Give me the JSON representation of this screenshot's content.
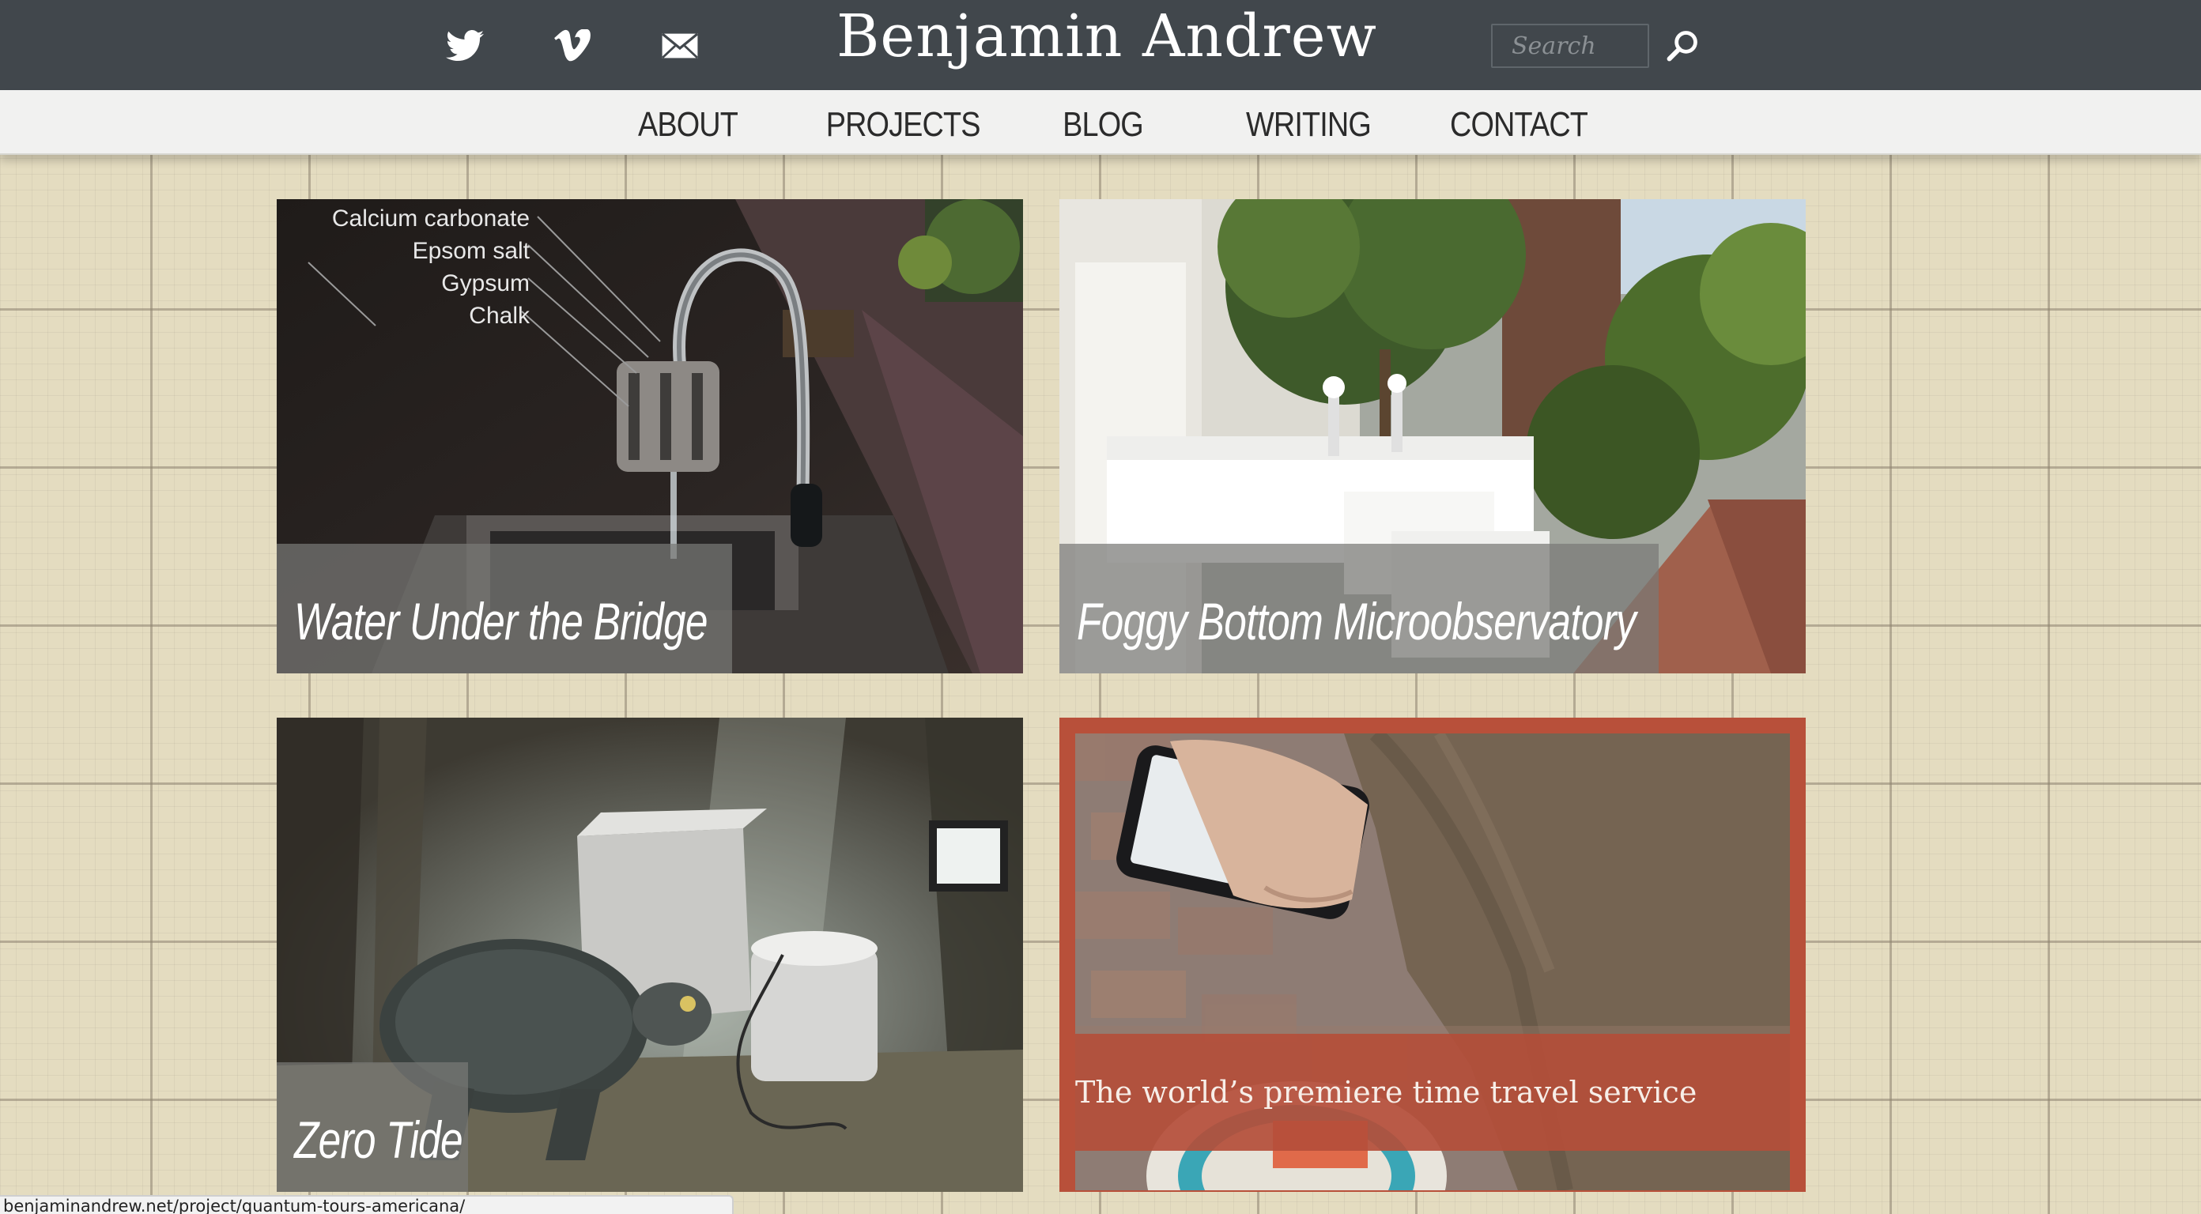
{
  "header": {
    "title": "Benjamin Andrew",
    "social": [
      "twitter-icon",
      "vimeo-icon",
      "mail-icon"
    ],
    "search": {
      "placeholder": "Search",
      "value": ""
    },
    "colors": {
      "bar": "#41474c",
      "title": "#ffffff"
    }
  },
  "nav": {
    "items": [
      {
        "label": "ABOUT"
      },
      {
        "label": "PROJECTS"
      },
      {
        "label": "BLOG"
      },
      {
        "label": "WRITING"
      },
      {
        "label": "CONTACT"
      }
    ]
  },
  "projects": [
    {
      "title": "Water Under the Bridge",
      "annotations": [
        "Calcium carbonate",
        "Epsom salt",
        "Gypsum",
        "Chalk"
      ]
    },
    {
      "title": "Foggy Bottom Microobservatory"
    },
    {
      "title": "Zero Tide"
    },
    {
      "title": "The world’s premiere time travel service",
      "accent": "#b8503a"
    }
  ],
  "status_bar": {
    "url": "benjaminandrew.net/project/quantum-tours-americana/"
  }
}
